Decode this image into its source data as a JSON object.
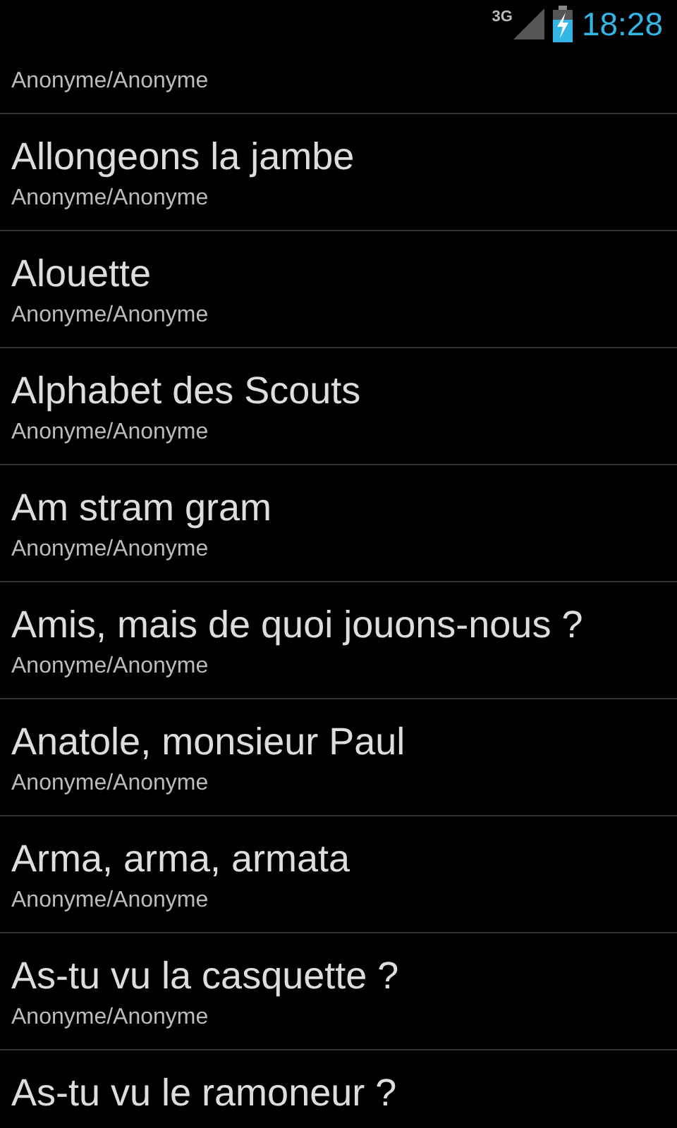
{
  "status_bar": {
    "network": "3G",
    "time": "18:28"
  },
  "songs": [
    {
      "author": "Anonyme/Anonyme"
    },
    {
      "title": "Allongeons la jambe",
      "author": "Anonyme/Anonyme"
    },
    {
      "title": "Alouette",
      "author": "Anonyme/Anonyme"
    },
    {
      "title": "Alphabet des Scouts",
      "author": "Anonyme/Anonyme"
    },
    {
      "title": "Am stram gram",
      "author": "Anonyme/Anonyme"
    },
    {
      "title": "Amis, mais de quoi jouons-nous ?",
      "author": "Anonyme/Anonyme"
    },
    {
      "title": "Anatole, monsieur Paul",
      "author": "Anonyme/Anonyme"
    },
    {
      "title": "Arma, arma, armata",
      "author": "Anonyme/Anonyme"
    },
    {
      "title": "As-tu vu la casquette ?",
      "author": "Anonyme/Anonyme"
    },
    {
      "title": "As-tu vu le ramoneur ?"
    }
  ]
}
